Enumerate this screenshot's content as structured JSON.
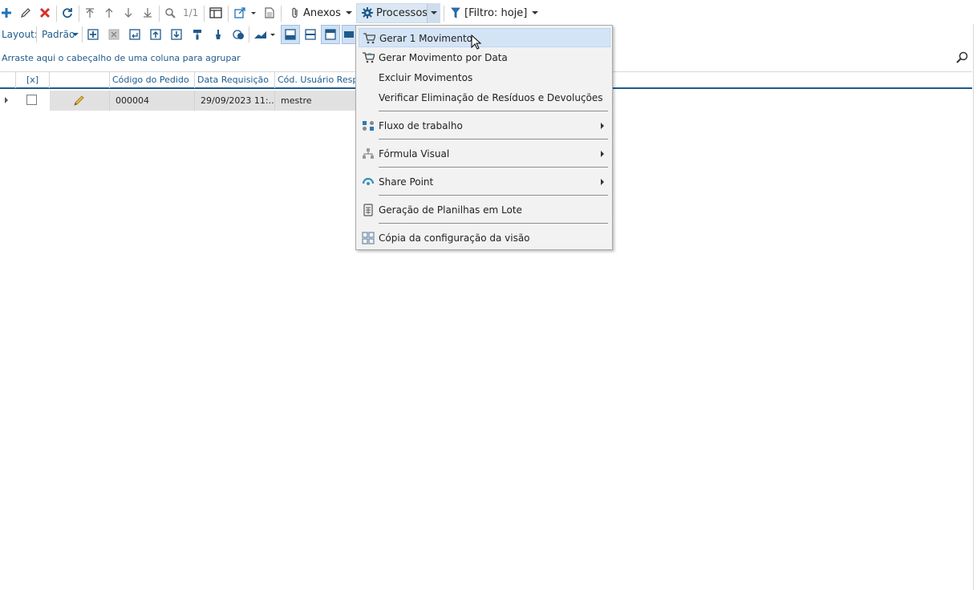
{
  "toolbar": {
    "pager": "1/1",
    "anexos_label": "Anexos",
    "processos_label": "Processos",
    "filtro_label": "[Filtro: hoje]"
  },
  "layout_bar": {
    "label": "Layout:",
    "selected": "Padrão"
  },
  "grid": {
    "group_hint": "Arraste aqui o cabeçalho de uma coluna para agrupar",
    "columns": [
      "[x]",
      "",
      "Código do Pedido",
      "Data Requisição",
      "Cód. Usuário Respon"
    ],
    "rows": [
      {
        "codigo": "000004",
        "data": "29/09/2023 11:...",
        "usuario": "mestre"
      }
    ]
  },
  "menu": {
    "items": [
      {
        "label": "Gerar 1 Movimento",
        "icon": "cart-icon"
      },
      {
        "label": "Gerar Movimento por Data",
        "icon": "cart-icon"
      },
      {
        "label": "Excluir Movimentos",
        "icon": ""
      },
      {
        "label": "Verificar Eliminação de Resíduos e Devoluções",
        "icon": ""
      },
      {
        "label": "Fluxo de trabalho",
        "icon": "workflow-icon"
      },
      {
        "label": "Fórmula Visual",
        "icon": "formula-icon"
      },
      {
        "label": "Share Point",
        "icon": "sharepoint-icon"
      },
      {
        "label": "Geração de Planilhas em Lote",
        "icon": "spreadsheet-icon"
      },
      {
        "label": "Cópia da configuração da visão",
        "icon": "grid-copy-icon"
      }
    ]
  },
  "colors": {
    "accent": "#1f5a8c",
    "delete_red": "#d9302b",
    "menu_highlight": "#d4e4f7"
  }
}
